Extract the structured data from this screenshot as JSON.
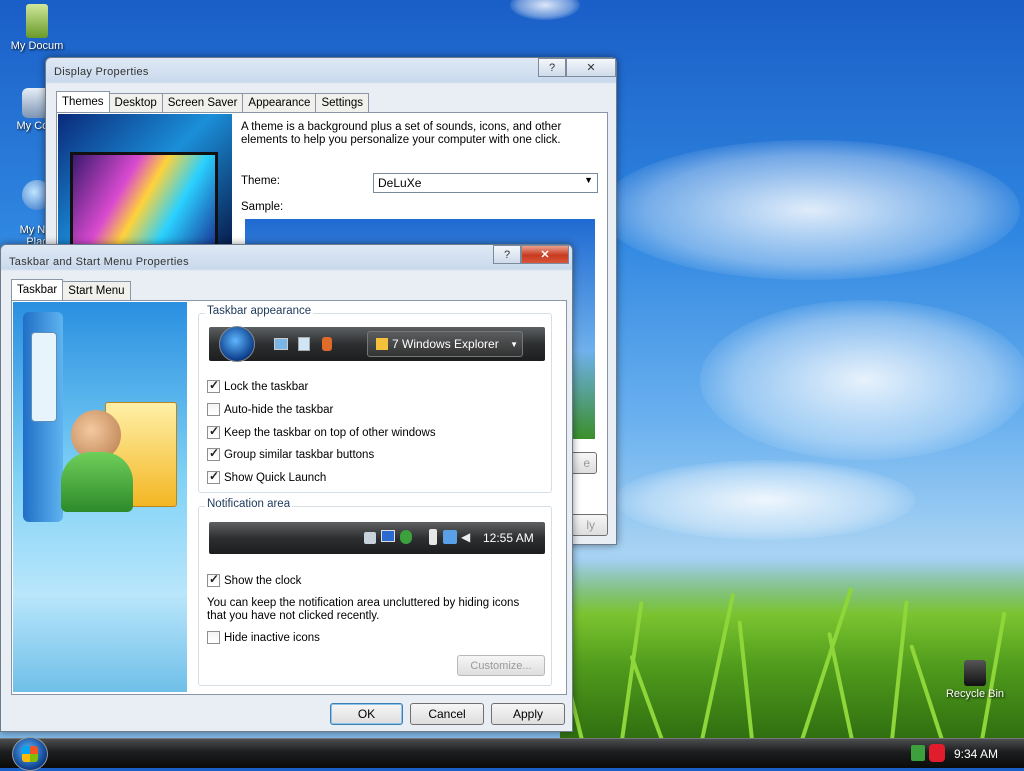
{
  "desktop": {
    "icons": [
      {
        "label": "My Docum"
      },
      {
        "label": "My Com"
      },
      {
        "label": "My Net\nPlac"
      },
      {
        "label": "Recycle Bin"
      }
    ]
  },
  "display_properties": {
    "title": "Display Properties",
    "help_label": "?",
    "close_label": "✕",
    "tabs": [
      "Themes",
      "Desktop",
      "Screen Saver",
      "Appearance",
      "Settings"
    ],
    "description": "A theme is a background plus a set of sounds, icons, and other elements to help you personalize your computer with one click.",
    "theme_label": "Theme:",
    "theme_value": "DeLuXe",
    "sample_label": "Sample:",
    "partial_button_1": "e",
    "partial_button_2": "ly"
  },
  "taskbar_props": {
    "title": "Taskbar and Start Menu Properties",
    "help_label": "?",
    "close_label": "✕",
    "tabs": [
      "Taskbar",
      "Start Menu"
    ],
    "appearance_group": "Taskbar appearance",
    "preview_button_label": "7 Windows Explorer",
    "options": [
      {
        "label": "Lock the taskbar",
        "checked": true
      },
      {
        "label": "Auto-hide the taskbar",
        "checked": false
      },
      {
        "label": "Keep the taskbar on top of other windows",
        "checked": true
      },
      {
        "label": "Group similar taskbar buttons",
        "checked": true
      },
      {
        "label": "Show Quick Launch",
        "checked": true
      }
    ],
    "notification_group": "Notification area",
    "preview_clock": "12:55 AM",
    "show_clock": {
      "label": "Show the clock",
      "checked": true
    },
    "hint_text": "You can keep the notification area uncluttered by hiding icons that you have not clicked recently.",
    "hide_inactive": {
      "label": "Hide inactive icons",
      "checked": false
    },
    "customize_label": "Customize...",
    "ok_label": "OK",
    "cancel_label": "Cancel",
    "apply_label": "Apply"
  },
  "taskbar": {
    "clock": "9:34 AM"
  },
  "colors": {
    "title_text": "#333333",
    "group_label": "#1e395b",
    "close_button": "#c83a1e"
  }
}
